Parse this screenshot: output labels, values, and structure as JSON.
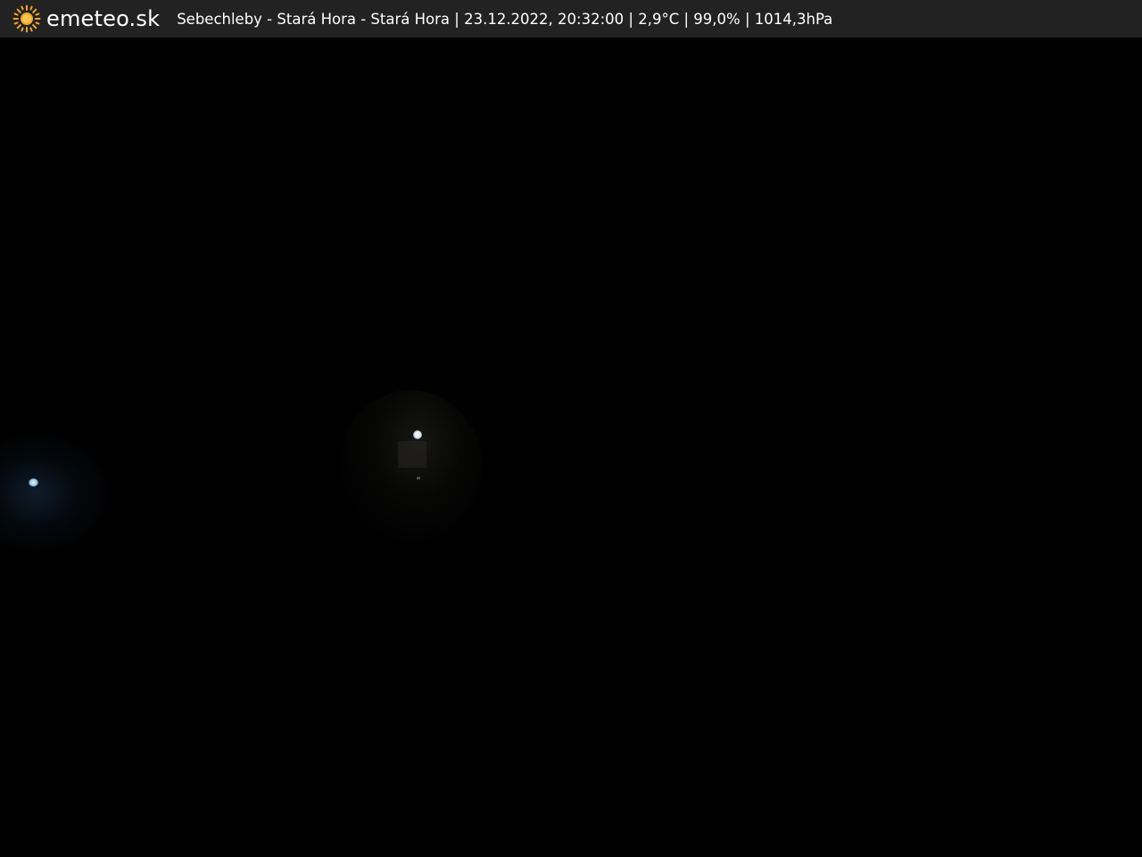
{
  "header": {
    "brand": "emeteo.sk",
    "location": "Sebechleby - Stará Hora - Stará Hora",
    "datetime": "23.12.2022, 20:32:00",
    "temperature": "2,9°C",
    "humidity": "99,0%",
    "pressure": "1014,3hPa",
    "separator": " | ",
    "logo_icon": "sun-icon",
    "logo_color": "#F5A623"
  },
  "scene": {
    "background_color": "#010101"
  }
}
